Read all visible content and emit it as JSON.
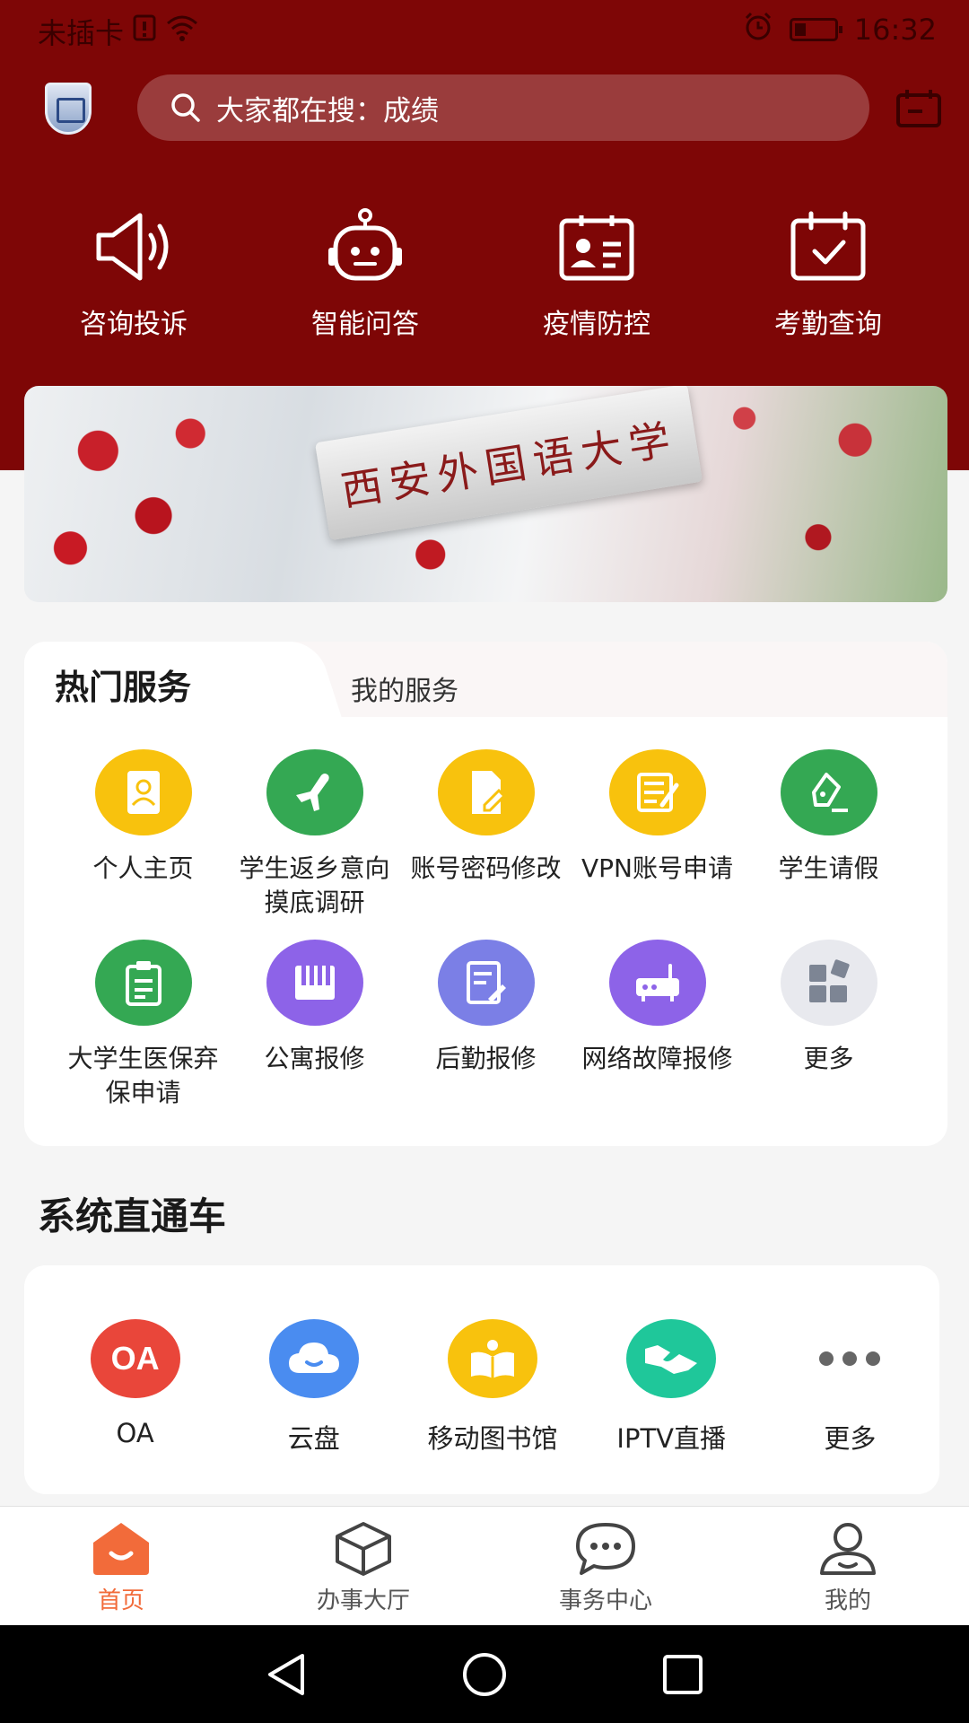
{
  "status_bar": {
    "carrier": "未插卡",
    "time": "16:32"
  },
  "header": {
    "search_placeholder": "大家都在搜：成绩"
  },
  "quick_nav": [
    {
      "label": "咨询投诉",
      "icon": "speaker-icon"
    },
    {
      "label": "智能问答",
      "icon": "robot-icon"
    },
    {
      "label": "疫情防控",
      "icon": "id-card-icon"
    },
    {
      "label": "考勤查询",
      "icon": "calendar-check-icon"
    }
  ],
  "banner": {
    "sign_text": "西安外国语大学"
  },
  "services": {
    "tabs": [
      "热门服务",
      "我的服务"
    ],
    "items": [
      {
        "label": "个人主页",
        "icon": "profile-icon",
        "color": "#f8c20d"
      },
      {
        "label": "学生返乡意向摸底调研",
        "icon": "airplane-icon",
        "color": "#34a853"
      },
      {
        "label": "账号密码修改",
        "icon": "document-edit-icon",
        "color": "#f8c20d"
      },
      {
        "label": "VPN账号申请",
        "icon": "form-icon",
        "color": "#f8c20d"
      },
      {
        "label": "学生请假",
        "icon": "pen-icon",
        "color": "#34a853"
      },
      {
        "label": "大学生医保弃保申请",
        "icon": "clipboard-icon",
        "color": "#34a853"
      },
      {
        "label": "公寓报修",
        "icon": "piano-icon",
        "color": "#8d63e8"
      },
      {
        "label": "后勤报修",
        "icon": "repair-doc-icon",
        "color": "#7b7fe6"
      },
      {
        "label": "网络故障报修",
        "icon": "router-icon",
        "color": "#8d63e8"
      },
      {
        "label": "更多",
        "icon": "grid-more-icon",
        "color": "#e8e9ee"
      }
    ]
  },
  "system": {
    "title": "系统直通车",
    "items": [
      {
        "label": "OA",
        "icon": "oa-icon",
        "color": "#e9463a",
        "badge": "OA"
      },
      {
        "label": "云盘",
        "icon": "cloud-icon",
        "color": "#4a8cf0"
      },
      {
        "label": "移动图书馆",
        "icon": "book-icon",
        "color": "#f8c20d"
      },
      {
        "label": "IPTV直播",
        "icon": "handshake-icon",
        "color": "#1fc79a"
      },
      {
        "label": "更多",
        "icon": "more-dots-icon",
        "color": "#ffffff"
      }
    ]
  },
  "bottom_nav": [
    {
      "label": "首页",
      "icon": "home-icon",
      "active": true
    },
    {
      "label": "办事大厅",
      "icon": "cube-icon",
      "active": false
    },
    {
      "label": "事务中心",
      "icon": "chat-icon",
      "active": false
    },
    {
      "label": "我的",
      "icon": "user-icon",
      "active": false
    }
  ],
  "colors": {
    "brand_red": "#7e0606",
    "active_orange": "#f26b3a"
  }
}
